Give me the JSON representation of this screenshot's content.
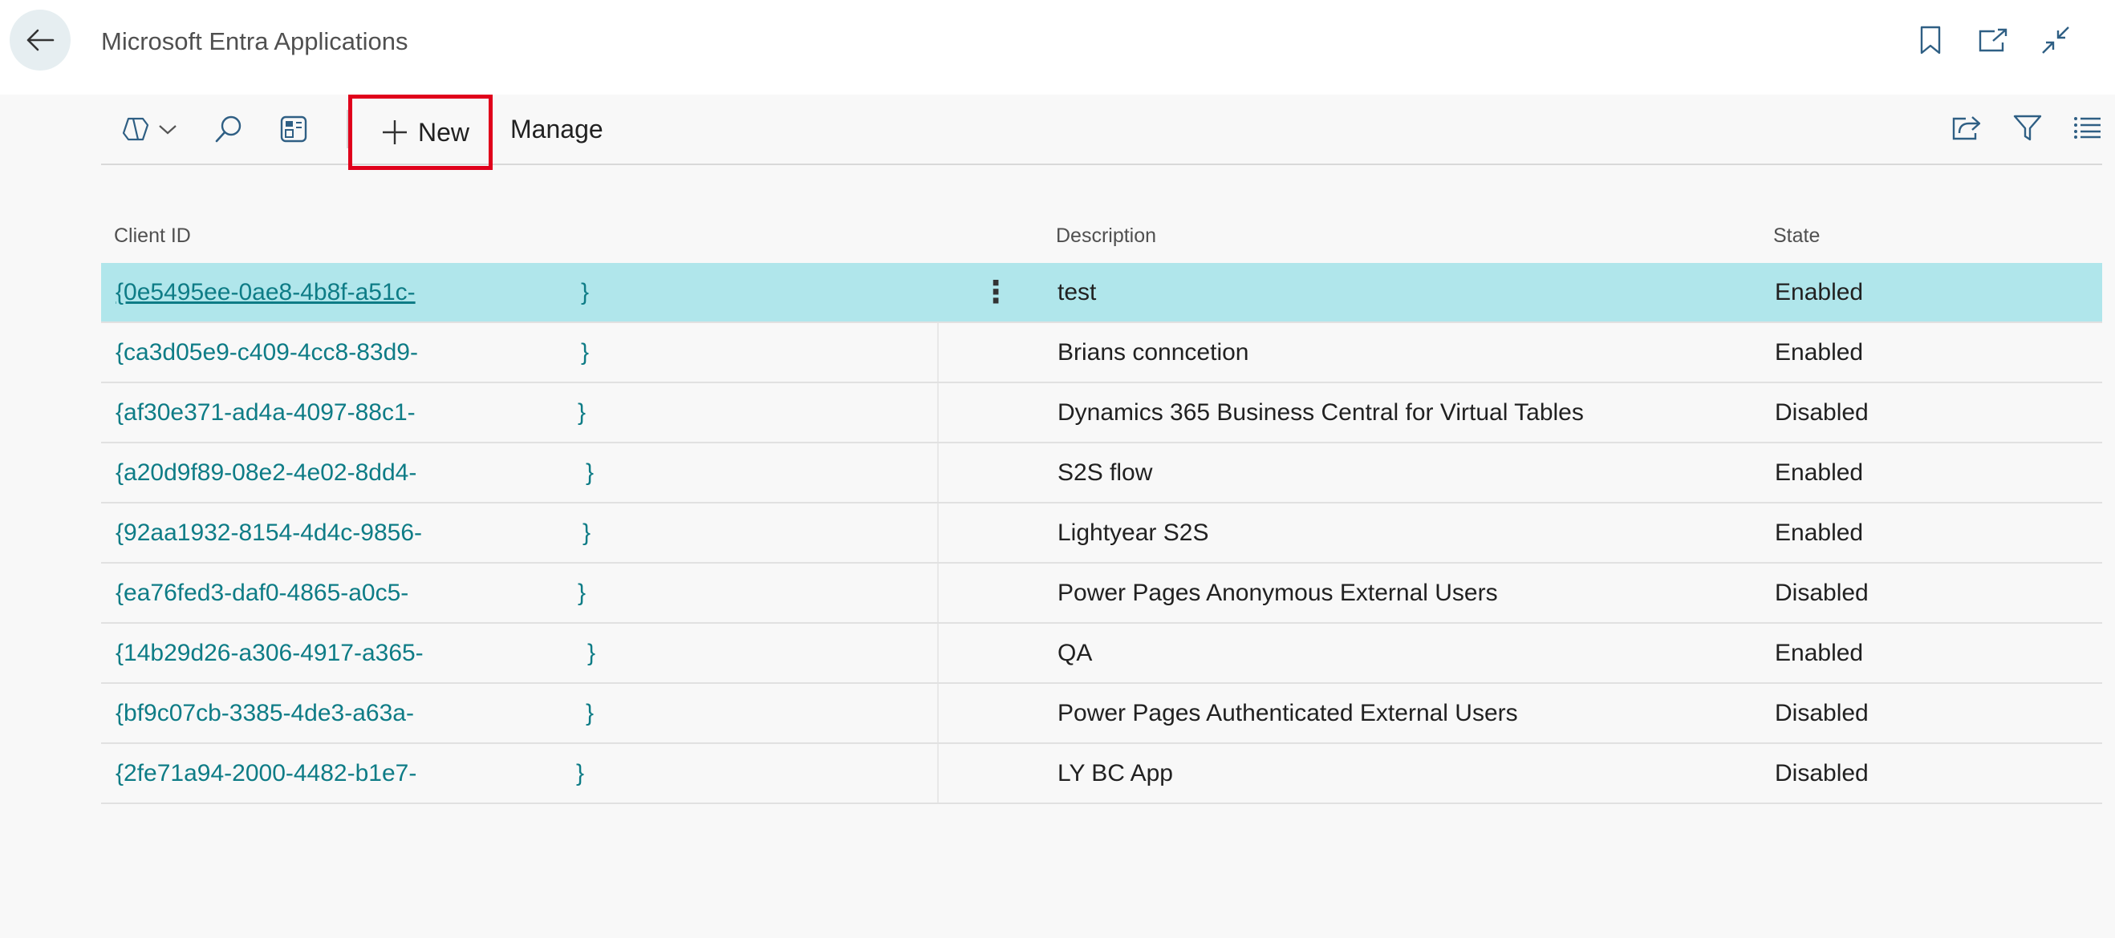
{
  "header": {
    "title": "Microsoft Entra Applications"
  },
  "toolbar": {
    "new_label": "New",
    "manage_label": "Manage"
  },
  "table": {
    "columns": [
      "Client ID",
      "Description",
      "State"
    ],
    "rows": [
      {
        "client_id": "{0e5495ee-0ae8-4b8f-a51c-",
        "brace": "}",
        "description": "test",
        "state": "Enabled"
      },
      {
        "client_id": "{ca3d05e9-c409-4cc8-83d9-",
        "brace": "}",
        "description": "Brians conncetion",
        "state": "Enabled"
      },
      {
        "client_id": "{af30e371-ad4a-4097-88c1-",
        "brace": "}",
        "description": "Dynamics 365 Business Central for Virtual Tables",
        "state": "Disabled"
      },
      {
        "client_id": "{a20d9f89-08e2-4e02-8dd4-",
        "brace": "}",
        "description": "S2S flow",
        "state": "Enabled"
      },
      {
        "client_id": "{92aa1932-8154-4d4c-9856-",
        "brace": "}",
        "description": "Lightyear S2S",
        "state": "Enabled"
      },
      {
        "client_id": "{ea76fed3-daf0-4865-a0c5-",
        "brace": "}",
        "description": "Power Pages Anonymous External Users",
        "state": "Disabled"
      },
      {
        "client_id": "{14b29d26-a306-4917-a365-",
        "brace": "}",
        "description": "QA",
        "state": "Enabled"
      },
      {
        "client_id": "{bf9c07cb-3385-4de3-a63a-",
        "brace": "}",
        "description": "Power Pages Authenticated External Users",
        "state": "Disabled"
      },
      {
        "client_id": "{2fe71a94-2000-4482-b1e7-",
        "brace": "}",
        "description": "LY BC App",
        "state": "Disabled"
      }
    ]
  },
  "colors": {
    "accent_teal": "#0e7c86",
    "selected_row": "#b0e6eb",
    "highlight_box": "#e0001b"
  }
}
